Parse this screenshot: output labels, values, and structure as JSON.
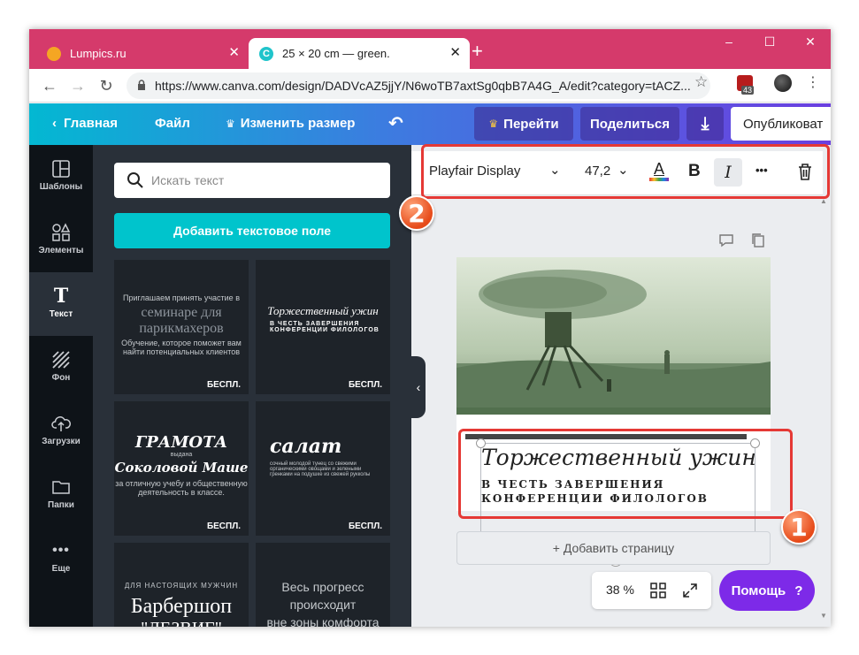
{
  "browser": {
    "tabs": [
      {
        "title": "Lumpics.ru",
        "favicon_color": "#f5a623"
      },
      {
        "title": "25 × 20 cm — green.",
        "favicon_color": "#20c4cb"
      }
    ],
    "url": "https://www.canva.com/design/DADVcAZ5jjY/N6woTB7axtSg0qbB7A4G_A/edit?category=tACZ...",
    "extension_badge": "43",
    "window_controls": [
      "–",
      "☐",
      "✕"
    ]
  },
  "header": {
    "back_label": "Главная",
    "file_label": "Файл",
    "resize_label": "Изменить размер",
    "goto_label": "Перейти",
    "share_label": "Поделиться",
    "publish_label": "Опубликоват"
  },
  "rail": {
    "items": [
      {
        "label": "Шаблоны",
        "icon": "templates-icon"
      },
      {
        "label": "Элементы",
        "icon": "elements-icon"
      },
      {
        "label": "Текст",
        "icon": "text-icon"
      },
      {
        "label": "Фон",
        "icon": "background-icon"
      },
      {
        "label": "Загрузки",
        "icon": "upload-icon"
      },
      {
        "label": "Папки",
        "icon": "folder-icon"
      },
      {
        "label": "Еще",
        "icon": "more-icon"
      }
    ],
    "active": "Текст"
  },
  "panel": {
    "search_placeholder": "Искать текст",
    "add_text_button": "Добавить текстовое поле",
    "free_badge": "БЕСПЛ.",
    "templates": [
      {
        "line1": "Приглашаем принять участие в",
        "line2": "семинаре для",
        "line3": "парикмахеров",
        "line4": "Обучение, которое поможет вам",
        "line5": "найти потенциальных клиентов"
      },
      {
        "line1": "Торжественный ужин",
        "line2": "В ЧЕСТЬ ЗАВЕРШЕНИЯ",
        "line3": "КОНФЕРЕНЦИИ ФИЛОЛОГОВ"
      },
      {
        "line1": "ГРАМОТА",
        "line2": "выдана",
        "line3": "Соколовой Маше",
        "line4": "за отличную учебу и общественную",
        "line5": "деятельность в классе."
      },
      {
        "line1": "салат",
        "line2": "сочный молодой тунец со свежими",
        "line3": "органическими овощами и зелеными",
        "line4": "гренками на подушке из свежей рукколы"
      },
      {
        "line1": "ДЛЯ НАСТОЯЩИХ МУЖЧИН",
        "line2": "Барбершоп",
        "line3": "\"ДЕЗВИГ\""
      },
      {
        "line1": "Весь прогресс",
        "line2": "происходит",
        "line3": "вне зоны комфорта"
      }
    ]
  },
  "toolbar": {
    "font": "Playfair Display",
    "size": "47,2",
    "bold": "B",
    "italic": "I",
    "more": "•••"
  },
  "canvas": {
    "heading": "Торжественный ужин",
    "sub1": "В ЧЕСТЬ ЗАВЕРШЕНИЯ",
    "sub2": "КОНФЕРЕНЦИИ ФИЛОЛОГОВ",
    "add_page": "+ Добавить страницу"
  },
  "footer": {
    "zoom": "38 %",
    "help": "Помощь",
    "help_mark": "?"
  },
  "annotations": [
    {
      "number": "1",
      "color": "#e53935"
    },
    {
      "number": "2",
      "color": "#e53935"
    }
  ]
}
